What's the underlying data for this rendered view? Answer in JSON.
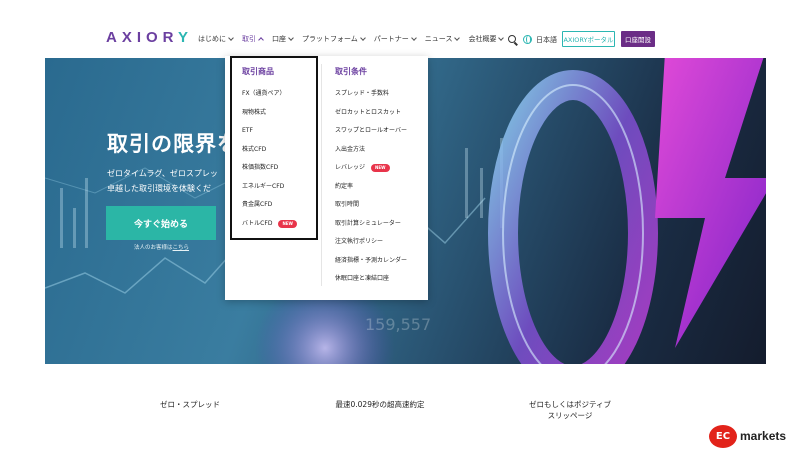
{
  "header": {
    "logo_a": "AXIOR",
    "logo_b": "Y",
    "nav": [
      {
        "label": "はじめに"
      },
      {
        "label": "取引"
      },
      {
        "label": "口座"
      },
      {
        "label": "プラットフォーム"
      },
      {
        "label": "パートナー"
      },
      {
        "label": "ニュース"
      },
      {
        "label": "会社概要"
      }
    ],
    "language": "日本語",
    "portal_button": "AXIORYポータル",
    "open_account_button": "口座開設"
  },
  "dropdown": {
    "col1": {
      "heading": "取引商品",
      "items": [
        {
          "label": "FX（通貨ペア）"
        },
        {
          "label": "現物株式"
        },
        {
          "label": "ETF"
        },
        {
          "label": "株式CFD"
        },
        {
          "label": "株価指数CFD"
        },
        {
          "label": "エネルギーCFD"
        },
        {
          "label": "貴金属CFD"
        },
        {
          "label": "バトルCFD",
          "badge": "NEW"
        }
      ]
    },
    "col2": {
      "heading": "取引条件",
      "items": [
        {
          "label": "スプレッド・手数料"
        },
        {
          "label": "ゼロカットとロスカット"
        },
        {
          "label": "スワップとロールオーバー"
        },
        {
          "label": "入出金方法"
        },
        {
          "label": "レバレッジ",
          "badge": "NEW"
        },
        {
          "label": "約定率"
        },
        {
          "label": "取引時間"
        },
        {
          "label": "取引計算シミュレーター"
        },
        {
          "label": "注文執行ポリシー"
        },
        {
          "label": "経済指標・予測カレンダー"
        },
        {
          "label": "休眠口座と凍結口座"
        }
      ]
    }
  },
  "hero": {
    "title": "取引の限界を",
    "subtitle_line1": "ゼロタイムラグ、ゼロスプレッ",
    "subtitle_line2": "卓越した取引環境を体験くだ",
    "cta": "今すぐ始める",
    "corp_note_prefix": "法人のお客様は",
    "corp_note_link": "こちら",
    "bg_number": "159,557"
  },
  "features": [
    {
      "line1": "ゼロ・スプレッド",
      "line2": ""
    },
    {
      "line1": "最速0.029秒の超高速約定",
      "line2": ""
    },
    {
      "line1": "ゼロもしくはポジティブ",
      "line2": "スリッページ"
    }
  ],
  "watermark": {
    "mark": "EC",
    "text": "markets"
  },
  "colors": {
    "brand_purple": "#6b3fa0",
    "teal": "#2bb6b2",
    "new_badge": "#e8344a"
  }
}
